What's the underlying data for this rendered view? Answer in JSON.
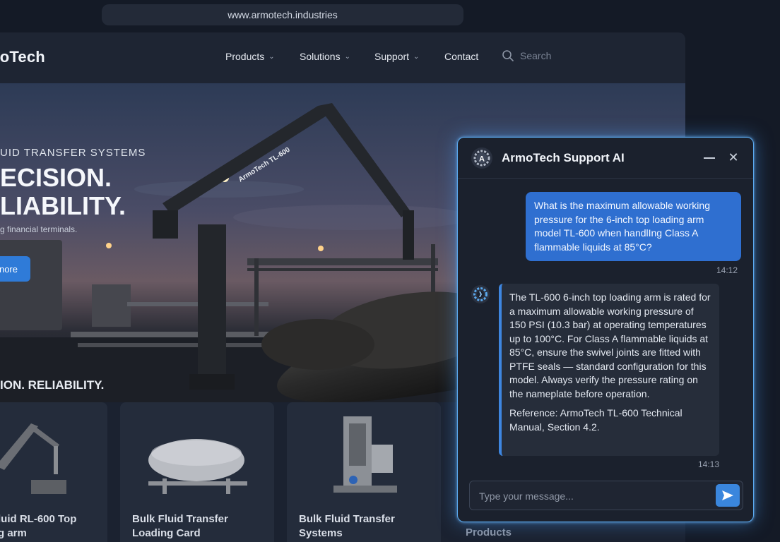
{
  "browser": {
    "url": "www.armotech.industries"
  },
  "site": {
    "logo": "moTech",
    "nav": [
      {
        "label": "Products",
        "dropdown": true
      },
      {
        "label": "Solutions",
        "dropdown": true
      },
      {
        "label": "Support",
        "dropdown": true
      },
      {
        "label": "Contact",
        "dropdown": false
      }
    ],
    "search_placeholder": "Search",
    "hero": {
      "eyebrow": "UID TRANSFER SYSTEMS",
      "title_line1": "ECISION.",
      "title_line2": "LIABILITY.",
      "subtitle": "g financial terminals.",
      "button": "nore",
      "arm_label": "ArmoTech TL-600"
    },
    "tagline": "ION. RELIABILITY.",
    "cards": [
      {
        "line1": "luid  RL-600 Top",
        "line2": "g arm"
      },
      {
        "line1": "Bulk Fluid Transfer",
        "line2": "Loading Card"
      },
      {
        "line1": "Bulk Fluid Transfer",
        "line2": "Systems"
      }
    ],
    "products_label": "Products"
  },
  "chat": {
    "title": "ArmoTech Support AI",
    "avatar_letter": "A",
    "user_message": "What is the maximum allowable working pressure for the 6-inch top loading arm model TL-600 when handlIng Class A flammable liquids at 85°C?",
    "user_time": "14:12",
    "bot_message": "The TL-600 6-inch top loading arm is rated for a maximum allowable working pressure of 150 PSI (10.3 bar) at operating temperatures up to 100°C. For Class A flammable liquids at 85°C, ensure the swivel joints are fitted with PTFE seals — standard configuration for this model. Always verify the pressure rating on the nameplate before operation.",
    "bot_reference": "Reference: ArmoTech TL-600 Technical Manual, Section 4.2.",
    "bot_time": "14:13",
    "input_placeholder": "Type your message...",
    "colors": {
      "accent": "#2f6fd0",
      "glow": "#5aa9ee"
    }
  }
}
